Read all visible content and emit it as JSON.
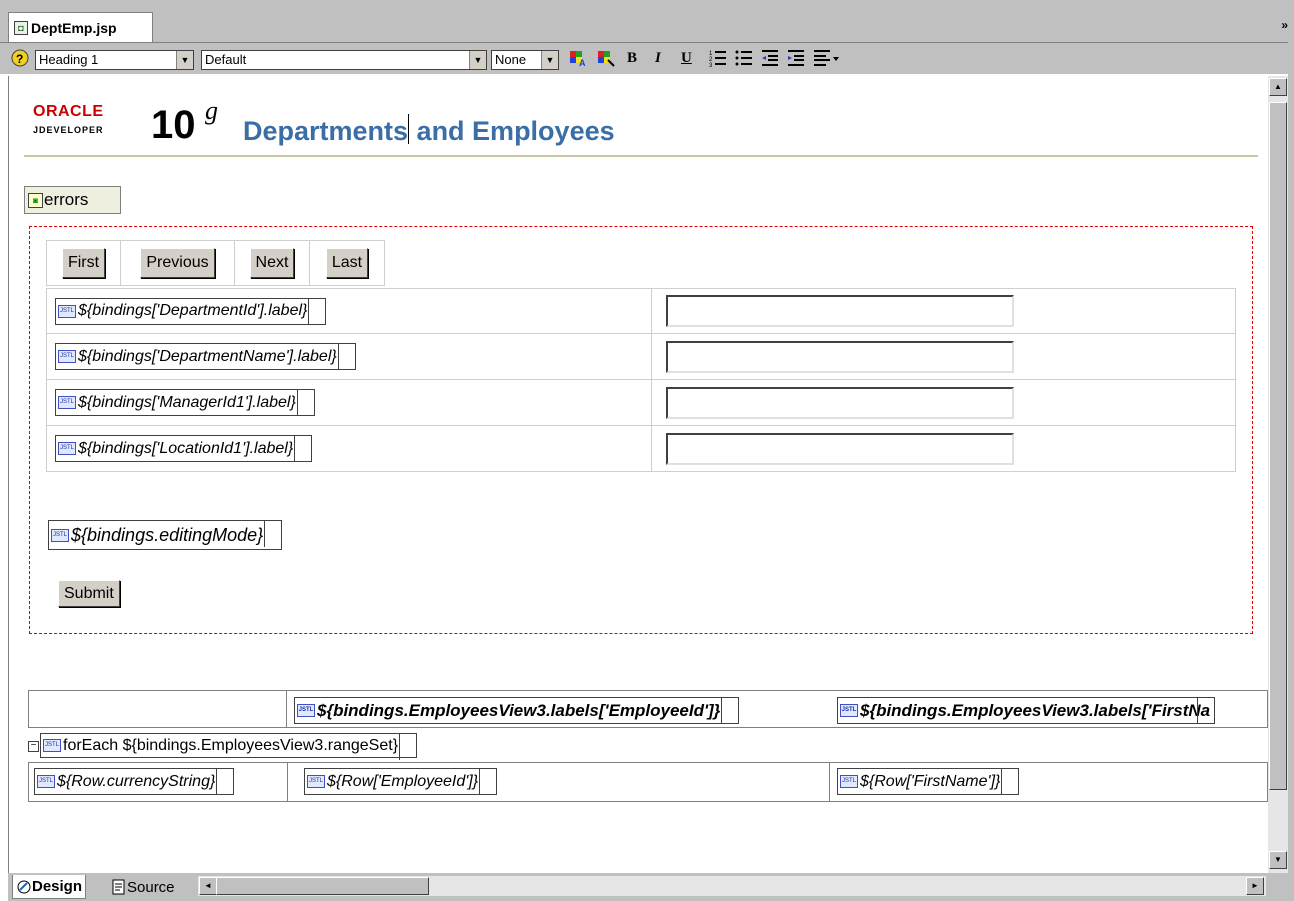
{
  "editor_tab": {
    "title": "DeptEmp.jsp",
    "overflow_icon": "double-chevron-down"
  },
  "toolbar": {
    "style_select": "Heading 1",
    "class_select": "Default",
    "font_select": "None",
    "bold": "B",
    "italic": "I",
    "underline": "U"
  },
  "header": {
    "oracle": "ORACLE",
    "jdeveloper": "JDEVELOPER",
    "version": "10",
    "version_suffix": "g",
    "title_part1": "Departments",
    "title_part2": " and Employees"
  },
  "errors_tag": "errors",
  "nav_buttons": [
    "First",
    "Previous",
    "Next",
    "Last"
  ],
  "fields": [
    {
      "label": "${bindings['DepartmentId'].label}",
      "value": ""
    },
    {
      "label": "${bindings['DepartmentName'].label}",
      "value": ""
    },
    {
      "label": "${bindings['ManagerId1'].label}",
      "value": ""
    },
    {
      "label": "${bindings['LocationId1'].label}",
      "value": ""
    }
  ],
  "editing_mode": "${bindings.editingMode}",
  "submit_label": "Submit",
  "employees_table": {
    "headers": [
      "${bindings.EmployeesView3.labels['EmployeeId']}",
      "${bindings.EmployeesView3.labels['FirstNa"
    ],
    "foreach": "forEach ${bindings.EmployeesView3.rangeSet}",
    "row": [
      "${Row.currencyString}",
      "${Row['EmployeeId']}",
      "${Row['FirstName']}"
    ]
  },
  "bottom_tabs": [
    "Design",
    "Source"
  ]
}
